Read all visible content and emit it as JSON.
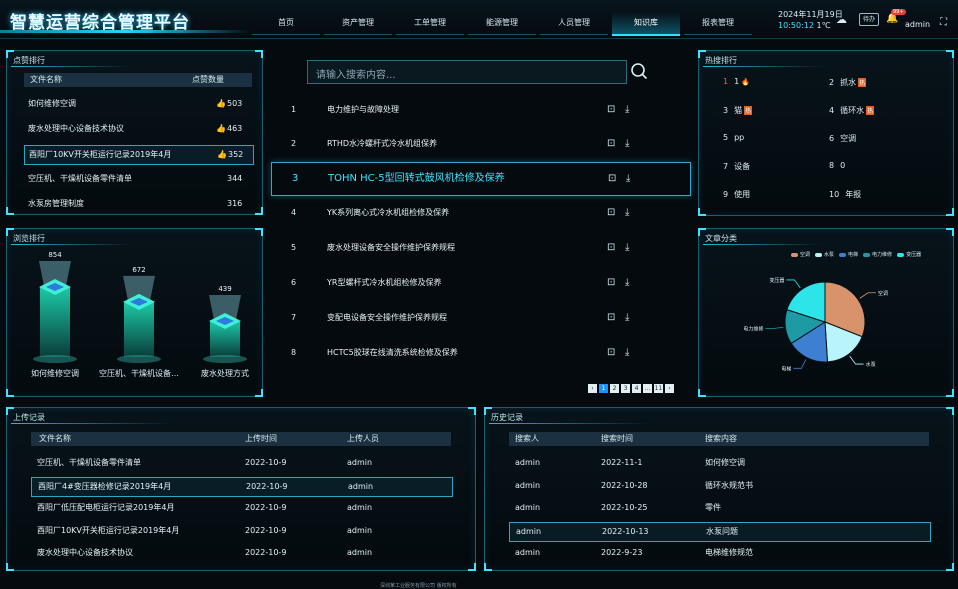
{
  "header": {
    "title": "智慧运营综合管理平台",
    "nav": [
      "首页",
      "资产管理",
      "工单管理",
      "能源管理",
      "人员管理",
      "知识库",
      "报表管理"
    ],
    "active_nav": 5,
    "date": "2024年11月19日",
    "time": "10:50:12",
    "temp": "1℃",
    "badge_btn": "待办",
    "notify_count": "99+",
    "user": "admin"
  },
  "like_rank": {
    "title": "点赞排行",
    "col_name": "文件名称",
    "col_count": "点赞数量",
    "rows": [
      {
        "name": "如何维修空调",
        "count": "503"
      },
      {
        "name": "废水处理中心设备技术协议",
        "count": "463"
      },
      {
        "name": "酉阳厂10KV开关柜运行记录2019年4月",
        "count": "352"
      },
      {
        "name": "空压机、干燥机设备零件清单",
        "count": "344"
      },
      {
        "name": "水泵房管理制度",
        "count": "316"
      }
    ]
  },
  "view_rank": {
    "title": "浏览排行",
    "items": [
      {
        "name": "如何维修空调",
        "value": "854"
      },
      {
        "name": "空压机、干燥机设备…",
        "value": "672"
      },
      {
        "name": "废水处理方式",
        "value": "439"
      }
    ]
  },
  "search": {
    "placeholder": "请输入搜索内容..."
  },
  "kb_list": [
    {
      "num": "1",
      "title": "电力维护与故障处理"
    },
    {
      "num": "2",
      "title": "RTHD水冷螺杆式冷水机组保养"
    },
    {
      "num": "3",
      "title": "TOHN HC-5型回转式鼓风机检修及保养"
    },
    {
      "num": "4",
      "title": "YK系列离心式冷水机组检修及保养"
    },
    {
      "num": "5",
      "title": "废水处理设备安全操作维护保养规程"
    },
    {
      "num": "6",
      "title": "YR型螺杆式冷水机组检修及保养"
    },
    {
      "num": "7",
      "title": "变配电设备安全操作维护保养规程"
    },
    {
      "num": "8",
      "title": "HCTC5胶球在线清洗系统检修及保养"
    }
  ],
  "kb_active": 2,
  "pager": [
    "‹",
    "1",
    "2",
    "3",
    "4",
    "…",
    "11",
    "›"
  ],
  "hot_search": {
    "title": "热搜排行",
    "items": [
      {
        "rank": "1",
        "word": "1",
        "hot": "🔥"
      },
      {
        "rank": "2",
        "word": "抓水",
        "tag": "热"
      },
      {
        "rank": "3",
        "word": "猫",
        "tag": "热"
      },
      {
        "rank": "4",
        "word": "循环水",
        "tag": "热"
      },
      {
        "rank": "5",
        "word": "pp"
      },
      {
        "rank": "6",
        "word": "空调"
      },
      {
        "rank": "7",
        "word": "设备"
      },
      {
        "rank": "8",
        "word": "0"
      },
      {
        "rank": "9",
        "word": "使用"
      },
      {
        "rank": "10",
        "word": "年报"
      }
    ]
  },
  "chart_data": {
    "type": "pie",
    "title": "文章分类",
    "series": [
      {
        "name": "空调",
        "value": 31,
        "color": "#d8936b"
      },
      {
        "name": "水泵",
        "value": 18,
        "color": "#b9f4fb"
      },
      {
        "name": "电梯",
        "value": 17,
        "color": "#3d7fd0"
      },
      {
        "name": "电力维修",
        "value": 14,
        "color": "#1d9aa4"
      },
      {
        "name": "变压器",
        "value": 20,
        "color": "#2de4e8"
      }
    ],
    "legend_position": "top"
  },
  "upload_records": {
    "title": "上传记录",
    "cols": [
      "文件名称",
      "上传时间",
      "上传人员"
    ],
    "rows": [
      [
        "空压机、干燥机设备零件清单",
        "2022-10-9",
        "admin"
      ],
      [
        "酉阳厂4#变压器检修记录2019年4月",
        "2022-10-9",
        "admin"
      ],
      [
        "酉阳厂低压配电柜运行记录2019年4月",
        "2022-10-9",
        "admin"
      ],
      [
        "酉阳厂10KV开关柜运行记录2019年4月",
        "2022-10-9",
        "admin"
      ],
      [
        "废水处理中心设备技术协议",
        "2022-10-9",
        "admin"
      ]
    ],
    "selected": 1
  },
  "history": {
    "title": "历史记录",
    "cols": [
      "搜索人",
      "搜索时间",
      "搜索内容"
    ],
    "rows": [
      [
        "admin",
        "2022-11-1",
        "如何修空调"
      ],
      [
        "admin",
        "2022-10-28",
        "循环水规范书"
      ],
      [
        "admin",
        "2022-10-25",
        "零件"
      ],
      [
        "admin",
        "2022-10-13",
        "水泵问题"
      ],
      [
        "admin",
        "2022-9-23",
        "电梯维修规范"
      ]
    ],
    "selected": 3
  },
  "footer": "深圳某工业服务有限公司 版权所有"
}
